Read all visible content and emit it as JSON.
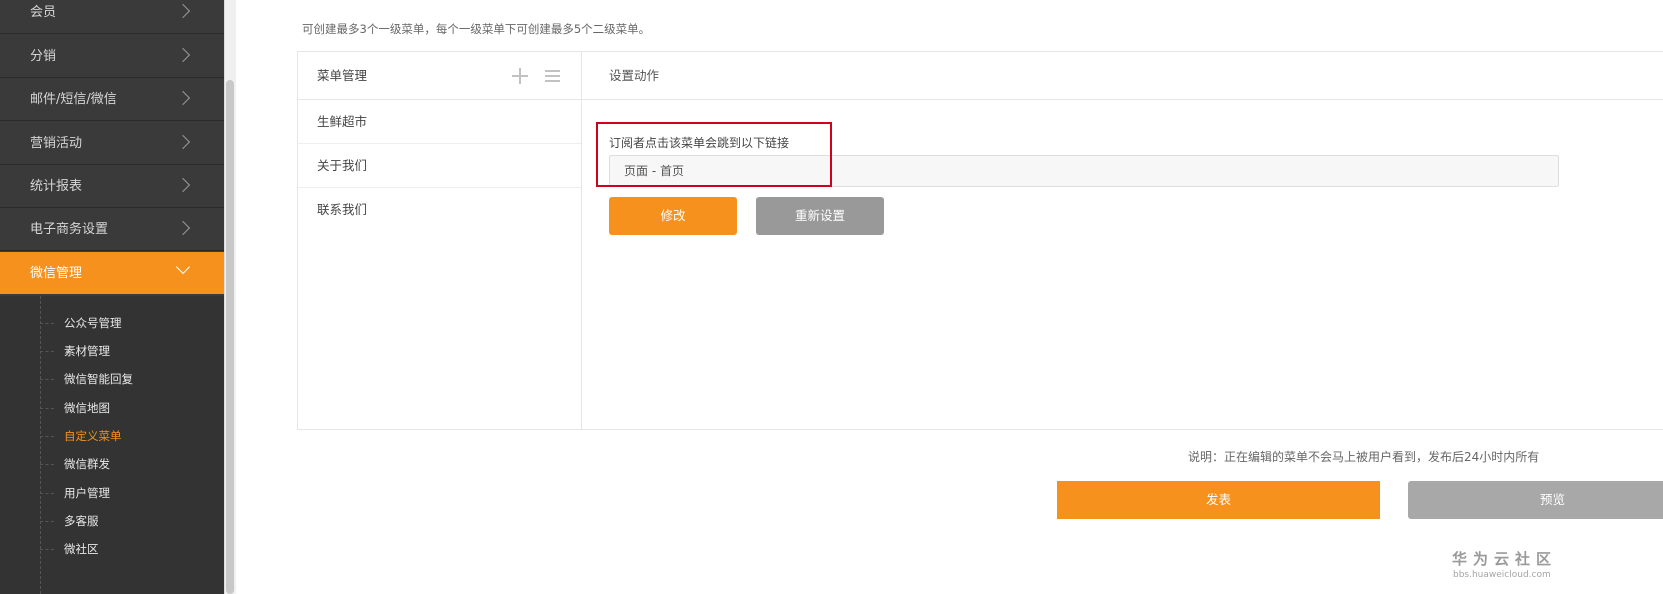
{
  "sidebar": {
    "items": [
      {
        "label": "会员"
      },
      {
        "label": "分销"
      },
      {
        "label": "邮件/短信/微信"
      },
      {
        "label": "营销活动"
      },
      {
        "label": "统计报表"
      },
      {
        "label": "电子商务设置"
      },
      {
        "label": "微信管理"
      }
    ],
    "submenu": [
      {
        "label": "公众号管理"
      },
      {
        "label": "素材管理"
      },
      {
        "label": "微信智能回复"
      },
      {
        "label": "微信地图"
      },
      {
        "label": "自定义菜单"
      },
      {
        "label": "微信群发"
      },
      {
        "label": "用户管理"
      },
      {
        "label": "多客服"
      },
      {
        "label": "微社区"
      }
    ],
    "active_item": "微信管理",
    "active_subitem": "自定义菜单"
  },
  "main": {
    "hint": "可创建最多3个一级菜单，每个一级菜单下可创建最多5个二级菜单。",
    "menu_panel": {
      "title": "菜单管理",
      "items": [
        {
          "label": "生鲜超市"
        },
        {
          "label": "关于我们"
        },
        {
          "label": "联系我们"
        }
      ]
    },
    "action_panel": {
      "title": "设置动作",
      "link_label": "订阅者点击该菜单会跳到以下链接",
      "link_value": "页面 - 首页",
      "modify_label": "修改",
      "reset_label": "重新设置"
    },
    "note": "说明：正在编辑的菜单不会马上被用户看到，发布后24小时内所有",
    "publish_label": "发表",
    "preview_label": "预览"
  },
  "watermark": {
    "title": "华为云社区",
    "url": "bbs.huaweicloud.com"
  },
  "colors": {
    "accent": "#f7911e",
    "sidebar_bg": "#3a3a3a",
    "highlight": "#d0021b"
  }
}
